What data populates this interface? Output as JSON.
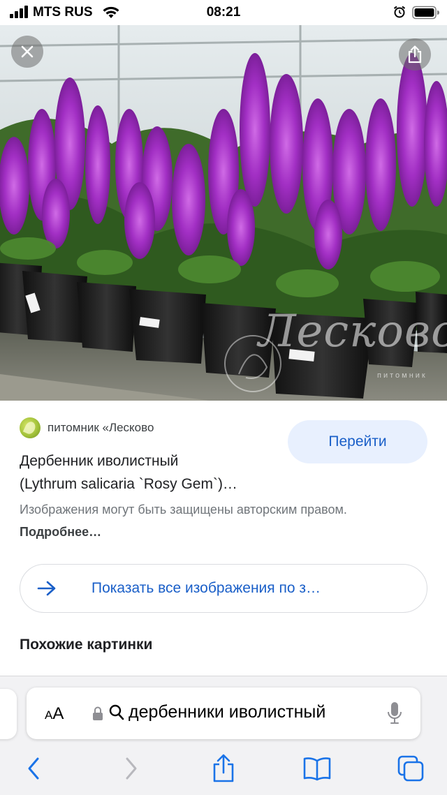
{
  "status_bar": {
    "carrier": "MTS RUS",
    "time": "08:21"
  },
  "hero": {
    "close_icon": "close-icon",
    "share_icon": "share-icon",
    "watermark_text": "Лесково",
    "watermark_sub": "питомник"
  },
  "result": {
    "source": "питомник «Лесково",
    "go_button": "Перейти",
    "title_line1": "Дербенник иволистный",
    "title_line2": "(Lythrum salicaria `Rosy Gem`)…",
    "copyright_text": "Изображения могут быть защищены авторским правом. ",
    "more_link": "Подробнее…",
    "show_all": "Показать все изображения по з…",
    "similar_heading": "Похожие картинки"
  },
  "safari": {
    "text_size_label_small": "A",
    "text_size_label_big": "A",
    "address_text": "дербенники иволистный",
    "icons": [
      "back-icon",
      "forward-icon",
      "share-icon",
      "bookmarks-icon",
      "tabs-icon"
    ]
  },
  "colors": {
    "accent": "#1a5fc8",
    "button_bg": "#e8f0fe",
    "flower": "#b23ad6"
  }
}
